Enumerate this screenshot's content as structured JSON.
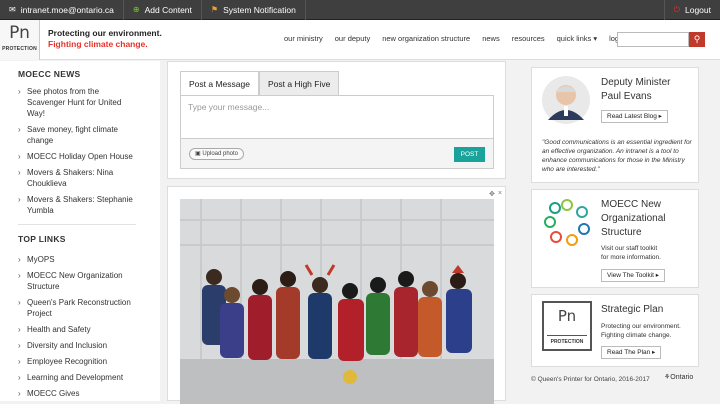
{
  "topbar": {
    "user": "intranet.moe@ontario.ca",
    "add": "Add Content",
    "notify": "System Notification",
    "logout": "Logout"
  },
  "logo": {
    "pn": "Pn",
    "protection": "PROTECTION"
  },
  "tagline": {
    "line1": "Protecting our environment.",
    "line2": "Fighting climate change."
  },
  "nav": [
    "our ministry",
    "our deputy",
    "new organization structure",
    "news",
    "resources",
    "quick links ▾",
    "log out"
  ],
  "left": {
    "news_title": "MOECC NEWS",
    "news": [
      "See photos from the Scavenger Hunt for United Way!",
      "Save money, fight climate change",
      "MOECC Holiday Open House",
      "Movers & Shakers: Nina Chouklieva",
      "Movers & Shakers: Stephanie Yumbla"
    ],
    "links_title": "TOP LINKS",
    "links": [
      "MyOPS",
      "MOECC New Organization Structure",
      "Queen's Park Reconstruction Project",
      "Health and Safety",
      "Diversity and Inclusion",
      "Employee Recognition",
      "Learning and Development",
      "MOECC Gives"
    ]
  },
  "post": {
    "tab1": "Post a Message",
    "tab2": "Post a High Five",
    "placeholder": "Type your message...",
    "upload": "Upload photo",
    "submit": "POST"
  },
  "right": {
    "deputy_title1": "Deputy Minister",
    "deputy_title2": "Paul Evans",
    "blog_btn": "Read Latest Blog ▸",
    "quote": "\"Good communications is an essential ingredient for an effective organization. An intranet is a tool to enhance communications for those in the Ministry who are interested.\"",
    "org_title1": "MOECC New",
    "org_title2": "Organizational",
    "org_title3": "Structure",
    "org_text1": "Visit our staff toolkit",
    "org_text2": "for more information.",
    "toolkit_btn": "View The Toolkit ▸",
    "plan_title": "Strategic Plan",
    "plan_text1": "Protecting our environment.",
    "plan_text2": "Fighting climate change.",
    "plan_btn": "Read The Plan ▸"
  },
  "footer": {
    "copy": "© Queen's Printer for Ontario, 2016-2017",
    "ontario": "Ontario"
  }
}
